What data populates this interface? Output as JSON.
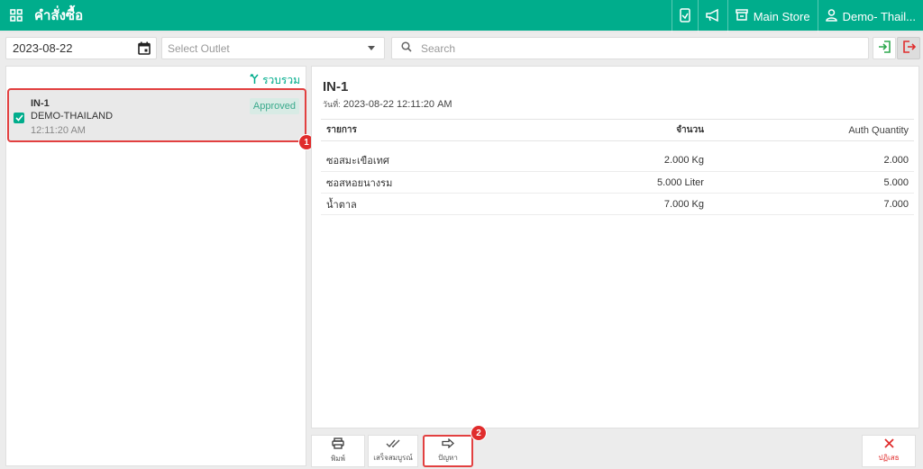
{
  "header": {
    "title": "คำสั่งซื้อ",
    "store_label": "Main Store",
    "user_label": "Demo- Thail..."
  },
  "filters": {
    "date_value": "2023-08-22",
    "outlet_placeholder": "Select Outlet",
    "search_placeholder": "Search"
  },
  "order_list": {
    "merge_label": "รวบรวม",
    "orders": [
      {
        "id": "IN-1",
        "outlet": "DEMO-THAILAND",
        "time": "12:11:20 AM",
        "status": "Approved",
        "checked": true
      }
    ]
  },
  "detail": {
    "title": "IN-1",
    "date_label": "วันที่:",
    "date_value": "2023-08-22 12:11:20 AM",
    "columns": {
      "item": "รายการ",
      "qty": "จำนวน",
      "auth": "Auth Quantity"
    },
    "rows": [
      {
        "item": "ซอสมะเขือเทศ",
        "qty": "2.000 Kg",
        "auth": "2.000"
      },
      {
        "item": "ซอสหอยนางรม",
        "qty": "5.000 Liter",
        "auth": "5.000"
      },
      {
        "item": "น้ำตาล",
        "qty": "7.000 Kg",
        "auth": "7.000"
      }
    ]
  },
  "toolbar": {
    "print_label": "พิมพ์",
    "complete_label": "เสร็จสมบูรณ์",
    "problem_label": "ปัญหา",
    "reject_label": "ปฏิเสธ"
  },
  "markers": [
    "1",
    "2"
  ],
  "colors": {
    "primary": "#00ad8c",
    "danger": "#e02c2c",
    "badge_bg": "#d8ebe5"
  }
}
